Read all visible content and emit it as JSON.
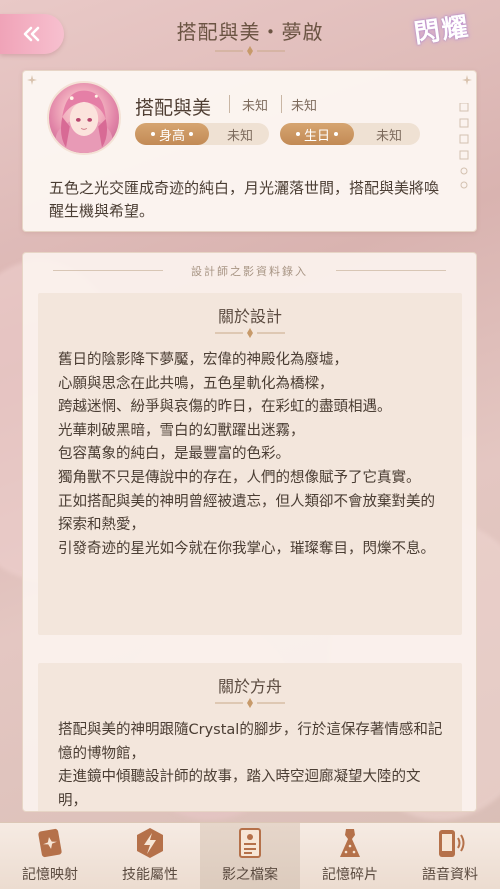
{
  "header": {
    "title": "搭配與美・夢啟",
    "brand_logo_text": "閃耀"
  },
  "profile": {
    "name": "搭配與美",
    "meta": [
      "未知",
      "未知"
    ],
    "height_label": "身高",
    "height_value": "未知",
    "birthday_label": "生日",
    "birthday_value": "未知",
    "description": "五色之光交匯成奇迹的純白，月光灑落世間，搭配與美將喚醒生機與希望。"
  },
  "archive": {
    "header": "設計師之影資料錄入",
    "sections": [
      {
        "title": "關於設計",
        "body": "舊日的陰影降下夢魘，宏偉的神殿化為廢墟，\n心願與思念在此共鳴，五色星軌化為橋樑，\n跨越迷惘、紛爭與哀傷的昨日，在彩虹的盡頭相遇。\n光華刺破黑暗，雪白的幻獸躍出迷霧，\n包容萬象的純白，是最豐富的色彩。\n獨角獸不只是傳說中的存在，人們的想像賦予了它真實。\n正如搭配與美的神明曾經被遺忘，但人類卻不會放棄對美的探索和熱愛，\n引發奇迹的星光如今就在你我掌心，璀璨奪目，閃爍不息。"
      },
      {
        "title": "關於方舟",
        "body": "搭配與美的神明跟隨Crystal的腳步，行於這保存著情感和記憶的博物館，\n走進鏡中傾聽設計師的故事，踏入時空迴廊凝望大陸的文明，"
      }
    ]
  },
  "nav": {
    "items": [
      {
        "label": "記憶映射",
        "icon": "memory-card-icon"
      },
      {
        "label": "技能屬性",
        "icon": "lightning-icon"
      },
      {
        "label": "影之檔案",
        "icon": "document-icon"
      },
      {
        "label": "記憶碎片",
        "icon": "dress-icon"
      },
      {
        "label": "語音資料",
        "icon": "phone-audio-icon"
      }
    ],
    "active_index": 2
  },
  "colors": {
    "accent_pink": "#f0a3b8",
    "tag_gold": "#c8905a",
    "panel_bg": "#fcf4ef"
  }
}
